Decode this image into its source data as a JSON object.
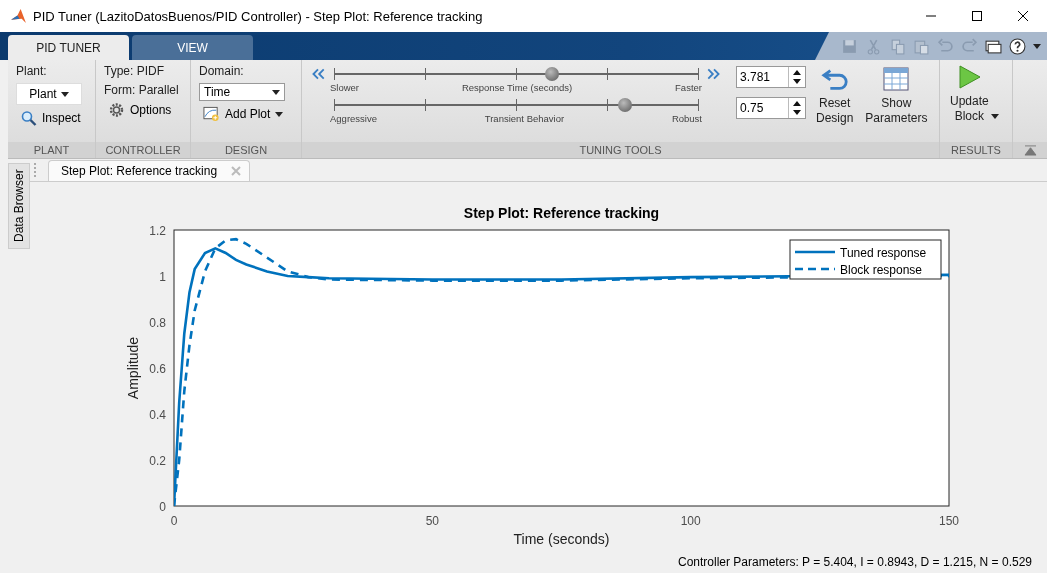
{
  "window": {
    "title": "PID Tuner (LazitoDatosBuenos/PID Controller) - Step Plot: Reference tracking"
  },
  "tabs": [
    {
      "label": "PID TUNER",
      "selected": true
    },
    {
      "label": "VIEW",
      "selected": false
    }
  ],
  "plant": {
    "heading": "Plant:",
    "dropdown": "Plant",
    "inspect": "Inspect",
    "section": "PLANT"
  },
  "controller": {
    "type_label": "Type:",
    "type": "PIDF",
    "form_label": "Form:",
    "form": "Parallel",
    "options": "Options",
    "section": "CONTROLLER"
  },
  "design": {
    "domain_label": "Domain:",
    "domain": "Time",
    "add_plot": "Add Plot",
    "section": "DESIGN"
  },
  "tuning": {
    "sliders": [
      {
        "left": "Slower",
        "caption": "Response Time (seconds)",
        "right": "Faster",
        "level": 0.6,
        "value": "3.781"
      },
      {
        "left": "Aggressive",
        "caption": "Transient Behavior",
        "right": "Robust",
        "level": 0.8,
        "value": "0.75"
      }
    ],
    "reset": "Reset Design",
    "show": "Show Parameters",
    "section": "TUNING TOOLS"
  },
  "results": {
    "update": "Update Block",
    "section": "RESULTS"
  },
  "side_panel": {
    "label": "Data Browser"
  },
  "doc_tabs": [
    {
      "label": "Step Plot: Reference tracking",
      "selected": true
    }
  ],
  "plot": {
    "chart_data": {
      "type": "line",
      "title": "Step Plot: Reference tracking",
      "xlabel": "Time (seconds)",
      "ylabel": "Amplitude",
      "x": [
        0,
        1,
        2,
        3,
        4,
        6,
        8,
        10,
        12,
        14,
        18,
        22,
        26,
        30,
        50,
        75,
        100,
        150
      ],
      "series": [
        {
          "name": "Tuned response",
          "color": "#0072bd",
          "line_style": "solid",
          "values": [
            0,
            0.45,
            0.75,
            0.93,
            1.03,
            1.1,
            1.12,
            1.1,
            1.07,
            1.05,
            1.02,
            1.0,
            0.995,
            0.99,
            0.985,
            0.985,
            0.995,
            1.005
          ]
        },
        {
          "name": "Block response",
          "color": "#0072bd",
          "line_style": "dashed",
          "values": [
            0,
            0.2,
            0.5,
            0.7,
            0.85,
            1.02,
            1.12,
            1.155,
            1.16,
            1.14,
            1.08,
            1.02,
            0.995,
            0.985,
            0.98,
            0.98,
            0.99,
            1.0
          ]
        }
      ],
      "legend": "upper right",
      "xlim": [
        0,
        150
      ],
      "ylim": [
        0,
        1.2
      ],
      "xticks": [
        0,
        50,
        100,
        150
      ],
      "yticks": [
        0,
        0.2,
        0.4,
        0.6,
        0.8,
        1,
        1.2
      ]
    }
  },
  "status": "Controller Parameters: P = 5.404, I = 0.8943, D = 1.215, N = 0.529"
}
